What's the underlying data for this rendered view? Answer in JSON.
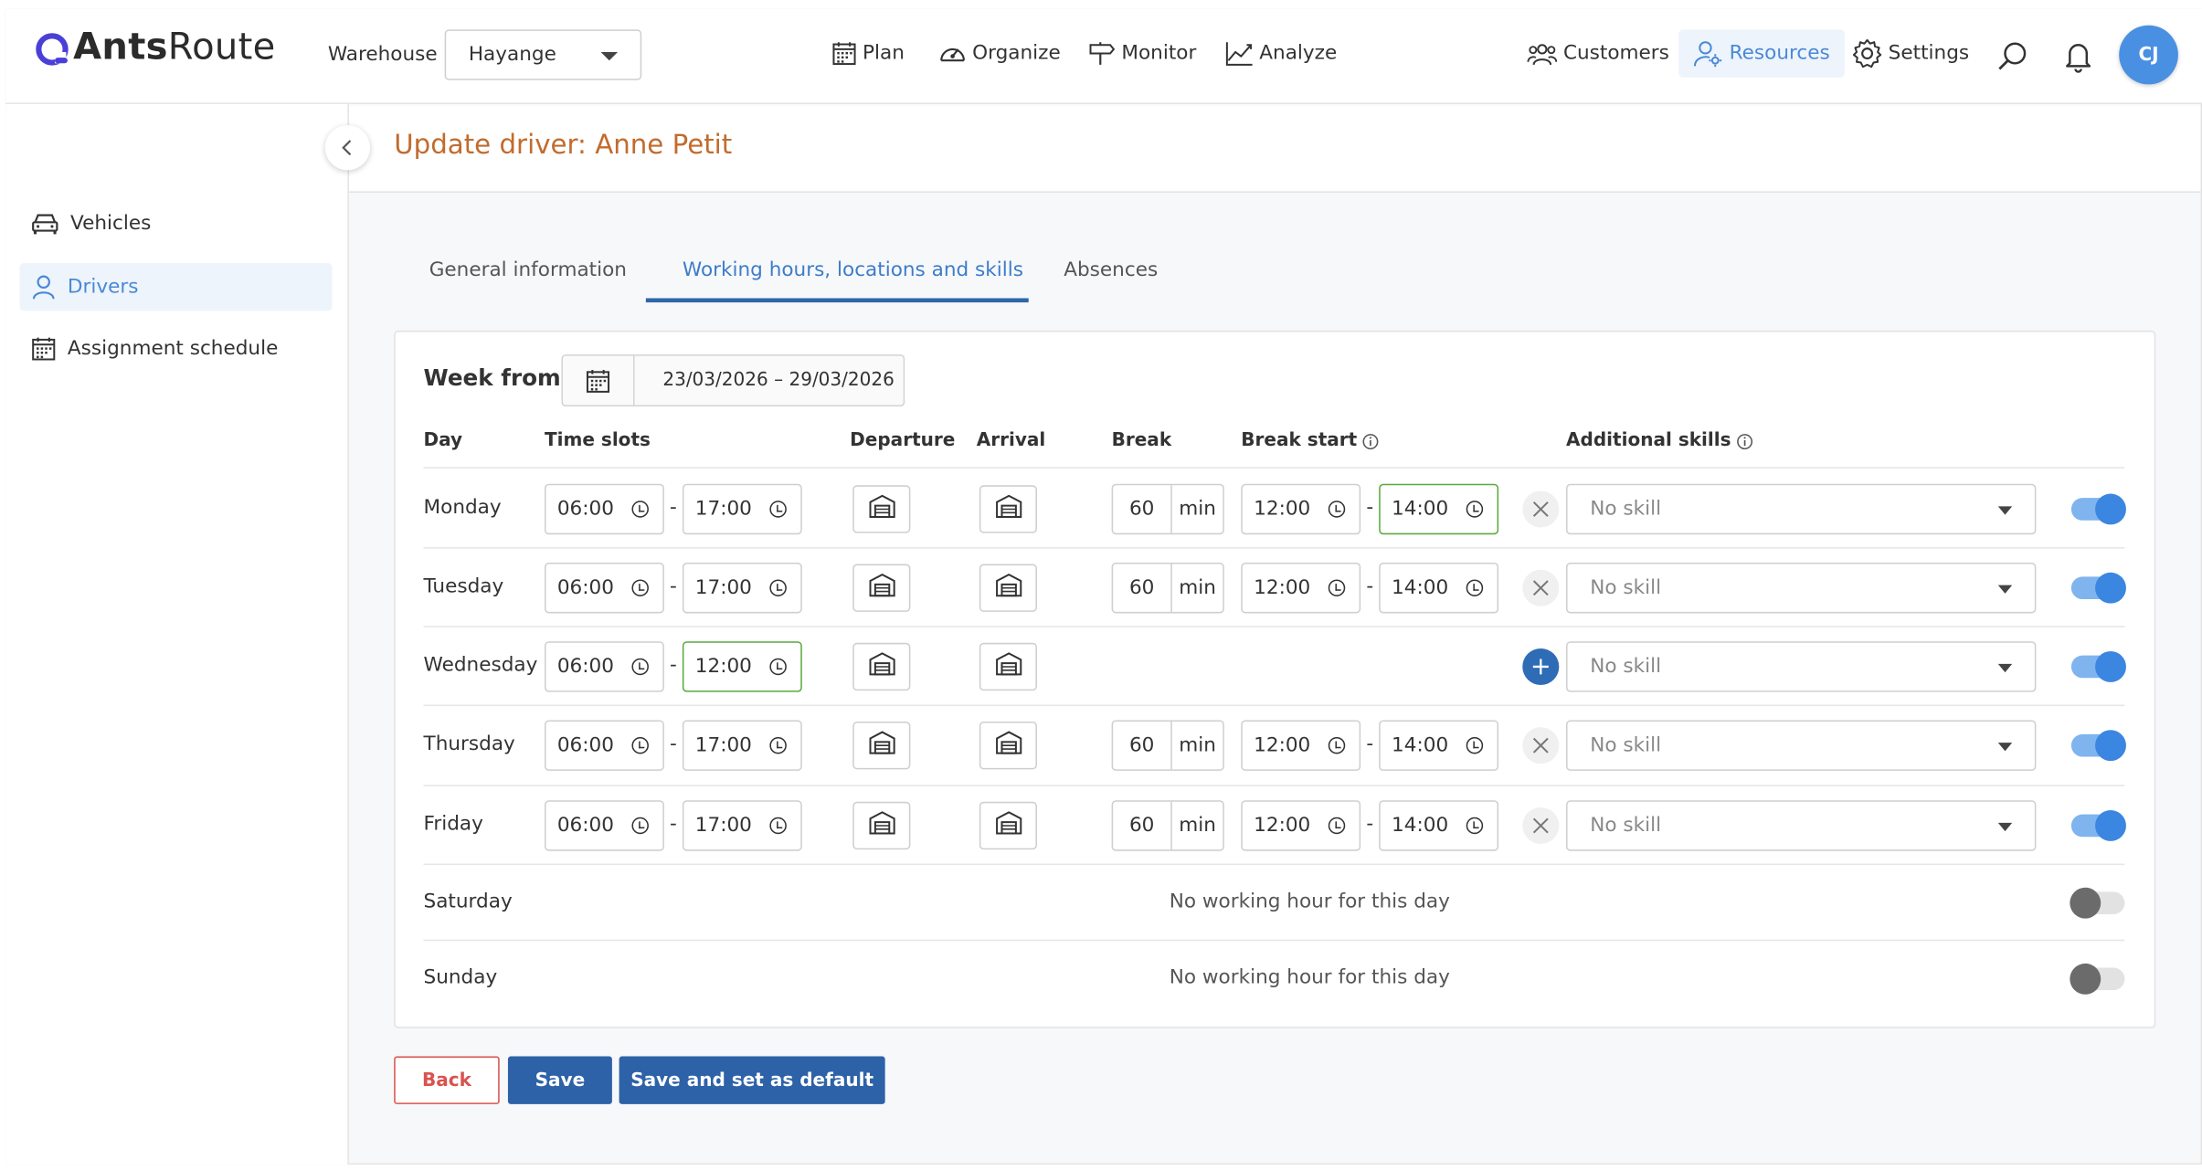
{
  "app": {
    "brand_bold": "Ants",
    "brand_light": "Route"
  },
  "header": {
    "warehouse_label": "Warehouse",
    "warehouse_value": "Hayange",
    "nav": {
      "plan": "Plan",
      "organize": "Organize",
      "monitor": "Monitor",
      "analyze": "Analyze",
      "customers": "Customers",
      "resources": "Resources",
      "settings": "Settings"
    },
    "avatar_initials": "CJ"
  },
  "sidebar": {
    "items": [
      {
        "label": "Vehicles",
        "icon": "car-icon"
      },
      {
        "label": "Drivers",
        "icon": "person-icon",
        "active": true
      },
      {
        "label": "Assignment schedule",
        "icon": "calendar-icon"
      }
    ]
  },
  "page": {
    "title": "Update driver: Anne Petit",
    "tabs": [
      "General information",
      "Working hours, locations and skills",
      "Absences"
    ],
    "active_tab": 1
  },
  "schedule": {
    "week_label": "Week from",
    "week_range": "23/03/2026 – 29/03/2026",
    "headers": {
      "day": "Day",
      "time_slots": "Time slots",
      "departure": "Departure",
      "arrival": "Arrival",
      "break": "Break",
      "break_start": "Break start",
      "additional_skills": "Additional skills"
    },
    "unit_min": "min",
    "no_working_text": "No working hour for this day",
    "days": [
      {
        "name": "Monday",
        "start": "06:00",
        "end": "17:00",
        "break": "60",
        "break_from": "12:00",
        "break_to": "14:00",
        "skill": "No skill",
        "enabled": true
      },
      {
        "name": "Tuesday",
        "start": "06:00",
        "end": "17:00",
        "break": "60",
        "break_from": "12:00",
        "break_to": "14:00",
        "skill": "No skill",
        "enabled": true
      },
      {
        "name": "Wednesday",
        "start": "06:00",
        "end": "12:00",
        "skill": "No skill",
        "enabled": true
      },
      {
        "name": "Thursday",
        "start": "06:00",
        "end": "17:00",
        "break": "60",
        "break_from": "12:00",
        "break_to": "14:00",
        "skill": "No skill",
        "enabled": true
      },
      {
        "name": "Friday",
        "start": "06:00",
        "end": "17:00",
        "break": "60",
        "break_from": "12:00",
        "break_to": "14:00",
        "skill": "No skill",
        "enabled": true
      },
      {
        "name": "Saturday",
        "enabled": false
      },
      {
        "name": "Sunday",
        "enabled": false
      }
    ]
  },
  "actions": {
    "back": "Back",
    "save": "Save",
    "save_default": "Save and set as default"
  },
  "colors": {
    "accent": "#3b86e0",
    "primary_button": "#2e62a8",
    "title": "#c26b2d",
    "danger": "#d9534f",
    "focus_border": "#5aaa3c"
  }
}
